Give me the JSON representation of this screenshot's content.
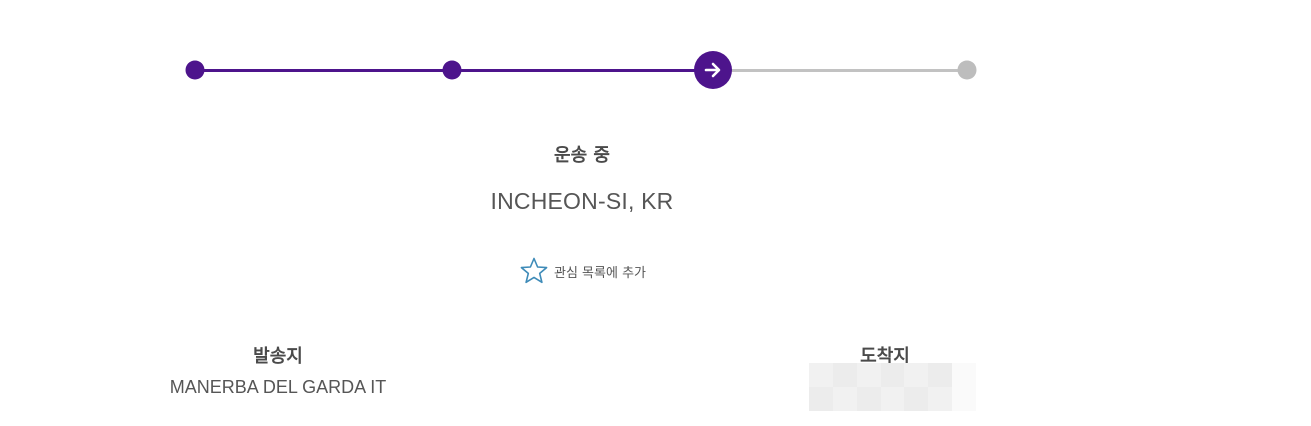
{
  "progress": {
    "completed_fraction": 0.67,
    "steps_total": 4,
    "current_step": 3,
    "accent_color": "#4d148c",
    "inactive_color": "#c2c2c2",
    "current_step_icon": "arrow-right-icon"
  },
  "status": {
    "label": "운송 중",
    "location": "INCHEON-SI, KR"
  },
  "watchlist": {
    "icon": "star-outline-icon",
    "label": "관심 목록에 추가"
  },
  "origin": {
    "heading": "발송지",
    "value": "MANERBA DEL GARDA IT"
  },
  "destination": {
    "heading": "도착지"
  }
}
